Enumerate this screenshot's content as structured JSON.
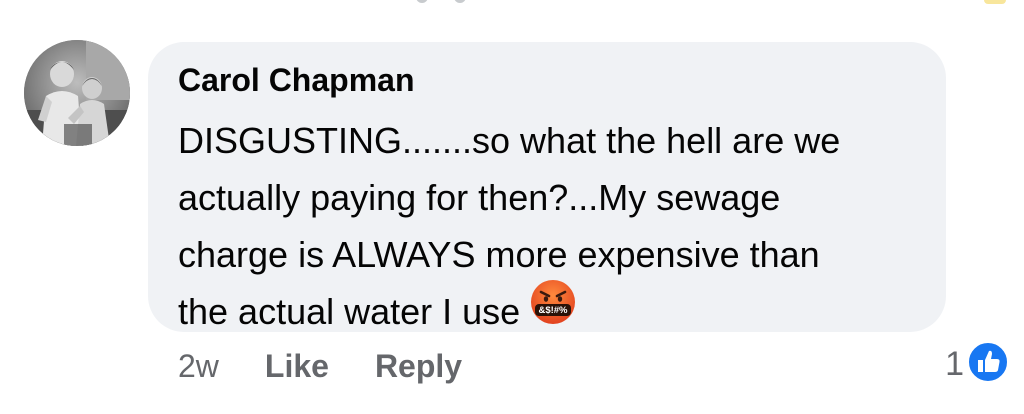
{
  "comment": {
    "author": "Carol Chapman",
    "lines": [
      "DISGUSTING.......so what the hell are we",
      "actually paying for then?...My sewage",
      "charge is ALWAYS more expensive than",
      "the actual water I use"
    ],
    "emoji": {
      "icon": "face-with-symbols-on-mouth-icon",
      "symbols": "&$!#%"
    },
    "timestamp": "2w",
    "like_label": "Like",
    "reply_label": "Reply",
    "reaction_count": "1",
    "reaction_icon": "thumbs-up-icon"
  },
  "colors": {
    "bubble": "#f0f2f5",
    "text": "#050505",
    "secondary_text": "#65676b",
    "like_blue": "#1877f2"
  }
}
